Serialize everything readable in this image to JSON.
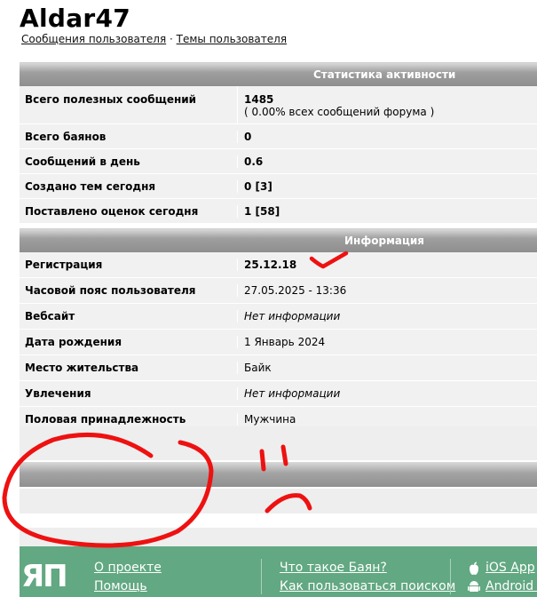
{
  "profile": {
    "username": "Aldar47",
    "links": [
      "Сообщения пользователя",
      "Темы пользователя"
    ],
    "link_separator": "·"
  },
  "stats": {
    "heading": "Статистика активности",
    "rows": [
      {
        "label": "Всего полезных сообщений",
        "value": "1485",
        "extra": "( 0.00% всех сообщений форума )"
      },
      {
        "label": "Всего баянов",
        "value": "0"
      },
      {
        "label": "Сообщений в день",
        "value": "0.6"
      },
      {
        "label": "Создано тем сегодня",
        "value": "0 [3]"
      },
      {
        "label": "Поставлено оценок сегодня",
        "value": "1 [58]"
      }
    ]
  },
  "info": {
    "heading": "Информация",
    "rows": [
      {
        "label": "Регистрация",
        "value": "25.12.18"
      },
      {
        "label": "Часовой пояс пользователя",
        "value": "27.05.2025 - 13:36"
      },
      {
        "label": "Вебсайт",
        "value": "Нет информации"
      },
      {
        "label": "Дата рождения",
        "value": "1 Январь 2024"
      },
      {
        "label": "Место жительства",
        "value": "Байк"
      },
      {
        "label": "Увлечения",
        "value": "Нет информации"
      },
      {
        "label": "Половая принадлежность",
        "value": "Мужчина"
      }
    ]
  },
  "footer": {
    "logo": "ЯП",
    "col1": [
      "О проекте",
      "Помощь"
    ],
    "col2": [
      "Что такое Баян?",
      "Как пользоваться поиском"
    ],
    "col3": [
      "iOS App",
      "Android A"
    ],
    "icons": [
      "apple-icon",
      "android-icon"
    ]
  },
  "colors": {
    "header_gray": "#9a9a9a",
    "row_bg": "#f1f1f1",
    "footer_green": "#62a882",
    "annotation_red": "#ee1111"
  }
}
